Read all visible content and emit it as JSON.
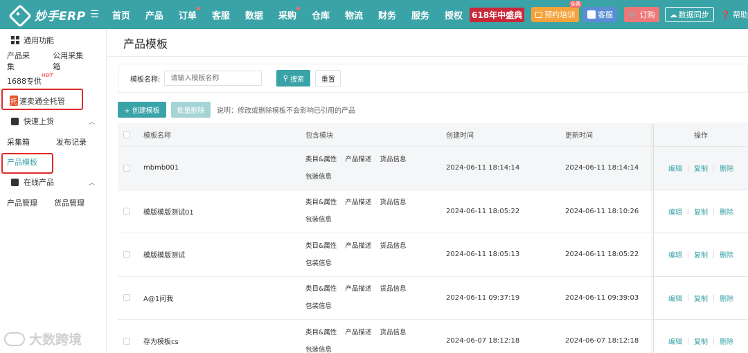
{
  "header": {
    "logo_text": "妙手ERP",
    "nav": [
      "首页",
      "产品",
      "订单",
      "客服",
      "数据",
      "采购",
      "仓库",
      "物流",
      "财务",
      "服务",
      "授权"
    ],
    "promo": "618年中盛典",
    "train": "预约培训",
    "free_badge": "免费",
    "cs": "客服",
    "order": "订购",
    "sync": "数据同步",
    "help": "帮助"
  },
  "sidebar": {
    "group_common": "通用功能",
    "row1": [
      "产品采集",
      "公用采集箱"
    ],
    "item_1688": "1688专供",
    "hot": "HOT",
    "tuo": "托",
    "sumaitong": "速卖通全托管",
    "group_quick": "快速上货",
    "row2": [
      "采集箱",
      "发布记录"
    ],
    "product_template": "产品模板",
    "group_online": "在线产品",
    "row3": [
      "产品管理",
      "货品管理"
    ]
  },
  "page": {
    "title": "产品模板",
    "filter_label": "模板名称:",
    "filter_placeholder": "请输入模板名称",
    "search_btn": "搜索",
    "reset_btn": "重置",
    "create_btn": "+ 创建模板",
    "batch_delete_btn": "批量删除",
    "note": "说明：修改或删除模板不会影响已引用的产品"
  },
  "table": {
    "headers": [
      "模板名称",
      "包含模块",
      "创建时间",
      "更新时间",
      "操作"
    ],
    "rows": [
      {
        "name": "mbmb001",
        "modules": [
          "类目&属性",
          "产品描述",
          "货品信息",
          "包装信息"
        ],
        "created": "2024-06-11 18:14:14",
        "updated": "2024-06-11 18:14:14"
      },
      {
        "name": "模版模版测试01",
        "modules": [
          "类目&属性",
          "产品描述",
          "货品信息",
          "包装信息"
        ],
        "created": "2024-06-11 18:05:22",
        "updated": "2024-06-11 18:10:26"
      },
      {
        "name": "模版模版测试",
        "modules": [
          "类目&属性",
          "产品描述",
          "货品信息",
          "包装信息"
        ],
        "created": "2024-06-11 18:05:13",
        "updated": "2024-06-11 18:05:22"
      },
      {
        "name": "A@1问我",
        "modules": [
          "类目&属性",
          "产品描述",
          "货品信息",
          "包装信息"
        ],
        "created": "2024-06-11 09:37:19",
        "updated": "2024-06-11 09:39:03"
      },
      {
        "name": "存为模板cs",
        "modules": [
          "类目&属性",
          "产品描述",
          "货品信息",
          "包装信息"
        ],
        "created": "2024-06-07 18:12:18",
        "updated": "2024-06-07 18:12:18"
      }
    ],
    "ops": [
      "编辑",
      "复制",
      "删除"
    ]
  },
  "watermark": "大数跨境",
  "colors": {
    "accent": "#3aa3a8",
    "highlight_box": "#e02a2a"
  }
}
